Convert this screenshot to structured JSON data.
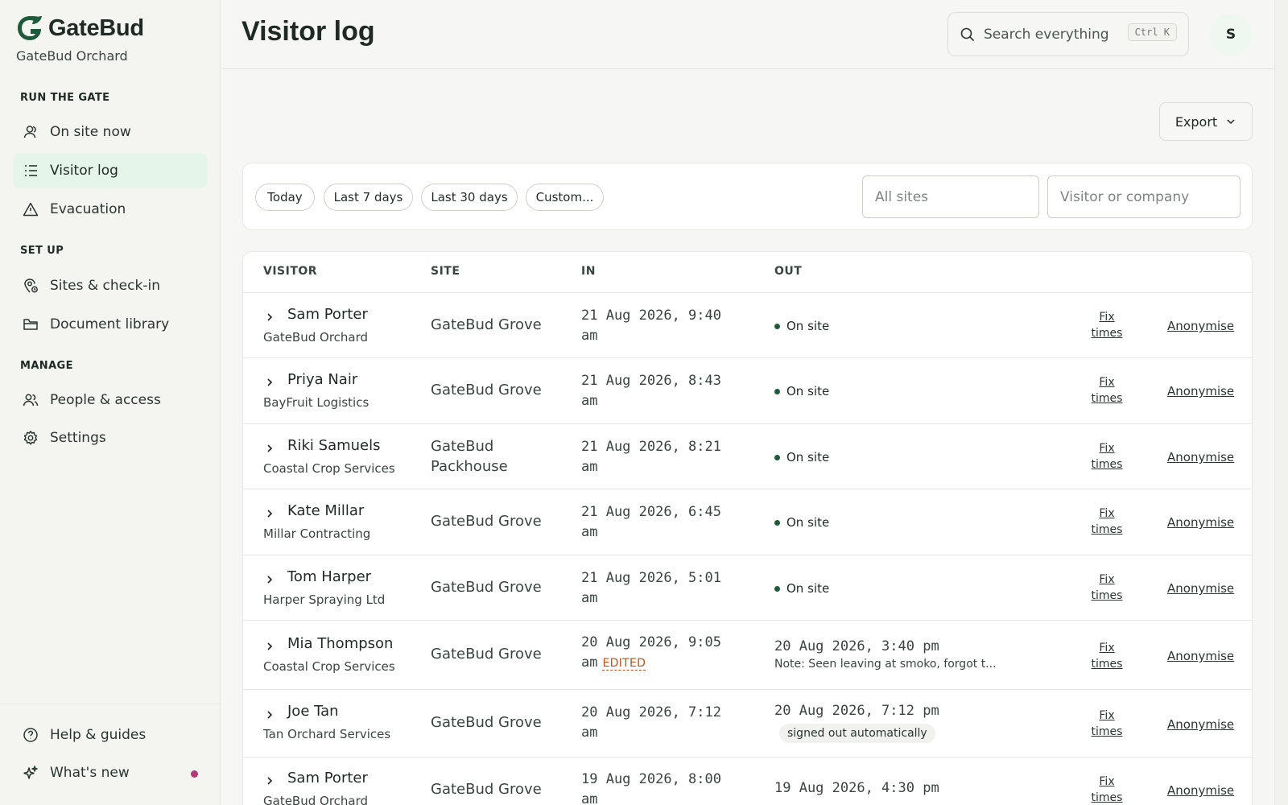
{
  "brand": {
    "name": "GateBud",
    "org": "GateBud Orchard"
  },
  "sidebar": {
    "sections": [
      {
        "label": "RUN THE GATE"
      },
      {
        "label": "SET UP"
      },
      {
        "label": "MANAGE"
      }
    ],
    "items": [
      {
        "label": "On site now",
        "icon": "user-icon"
      },
      {
        "label": "Visitor log",
        "icon": "list-icon",
        "active": true
      },
      {
        "label": "Evacuation",
        "icon": "warning-icon"
      },
      {
        "label": "Sites & check-in",
        "icon": "location-icon"
      },
      {
        "label": "Document library",
        "icon": "folder-icon"
      },
      {
        "label": "People & access",
        "icon": "users-icon"
      },
      {
        "label": "Settings",
        "icon": "gear-icon"
      }
    ],
    "footer": [
      {
        "label": "Help & guides",
        "icon": "help-icon"
      },
      {
        "label": "What's new",
        "icon": "sparkle-icon"
      }
    ]
  },
  "header": {
    "title": "Visitor log",
    "search_placeholder": "Search everything",
    "shortcut": "Ctrl K",
    "avatar_initial": "S"
  },
  "toolbar": {
    "export_label": "Export"
  },
  "filters": {
    "chips": [
      "Today",
      "Last 7 days",
      "Last 30 days",
      "Custom..."
    ],
    "site_placeholder": "All sites",
    "visitor_placeholder": "Visitor or company"
  },
  "table": {
    "columns": [
      "VISITOR",
      "SITE",
      "IN",
      "OUT"
    ],
    "fix_label_1": "Fix",
    "fix_label_2": "times",
    "anonymise_label": "Anonymise",
    "rows": [
      {
        "name": "Sam Porter",
        "company": "GateBud Orchard",
        "site": "GateBud Grove",
        "in_date": "21 Aug 2026, 9:40",
        "in_ampm": "am",
        "status": "On site"
      },
      {
        "name": "Priya Nair",
        "company": "BayFruit Logistics",
        "site": "GateBud Grove",
        "in_date": "21 Aug 2026, 8:43",
        "in_ampm": "am",
        "status": "On site"
      },
      {
        "name": "Riki Samuels",
        "company": "Coastal Crop Services",
        "site": "GateBud Packhouse",
        "in_date": "21 Aug 2026, 8:21",
        "in_ampm": "am",
        "status": "On site"
      },
      {
        "name": "Kate Millar",
        "company": "Millar Contracting",
        "site": "GateBud Grove",
        "in_date": "21 Aug 2026, 6:45",
        "in_ampm": "am",
        "status": "On site"
      },
      {
        "name": "Tom Harper",
        "company": "Harper Spraying Ltd",
        "site": "GateBud Grove",
        "in_date": "21 Aug 2026, 5:01",
        "in_ampm": "am",
        "status": "On site"
      },
      {
        "name": "Mia Thompson",
        "company": "Coastal Crop Services",
        "site": "GateBud Grove",
        "in_date": "20 Aug 2026, 9:05",
        "in_ampm": "am",
        "edited": "EDITED",
        "out": "20 Aug 2026, 3:40 pm",
        "note": "Note: Seen leaving at smoko, forgot t..."
      },
      {
        "name": "Joe Tan",
        "company": "Tan Orchard Services",
        "site": "GateBud Grove",
        "in_date": "20 Aug 2026, 7:12",
        "in_ampm": "am",
        "out": "20 Aug 2026, 7:12 pm",
        "badge": "signed out automatically"
      },
      {
        "name": "Sam Porter",
        "company": "GateBud Orchard",
        "site": "GateBud Grove",
        "in_date": "19 Aug 2026, 8:00",
        "in_ampm": "am",
        "out": "19 Aug 2026, 4:30 pm"
      }
    ]
  },
  "colors": {
    "accent": "#1f5a3a",
    "active_bg": "#e6f5ea",
    "edited": "#b5541c",
    "new_dot": "#b2387a"
  }
}
